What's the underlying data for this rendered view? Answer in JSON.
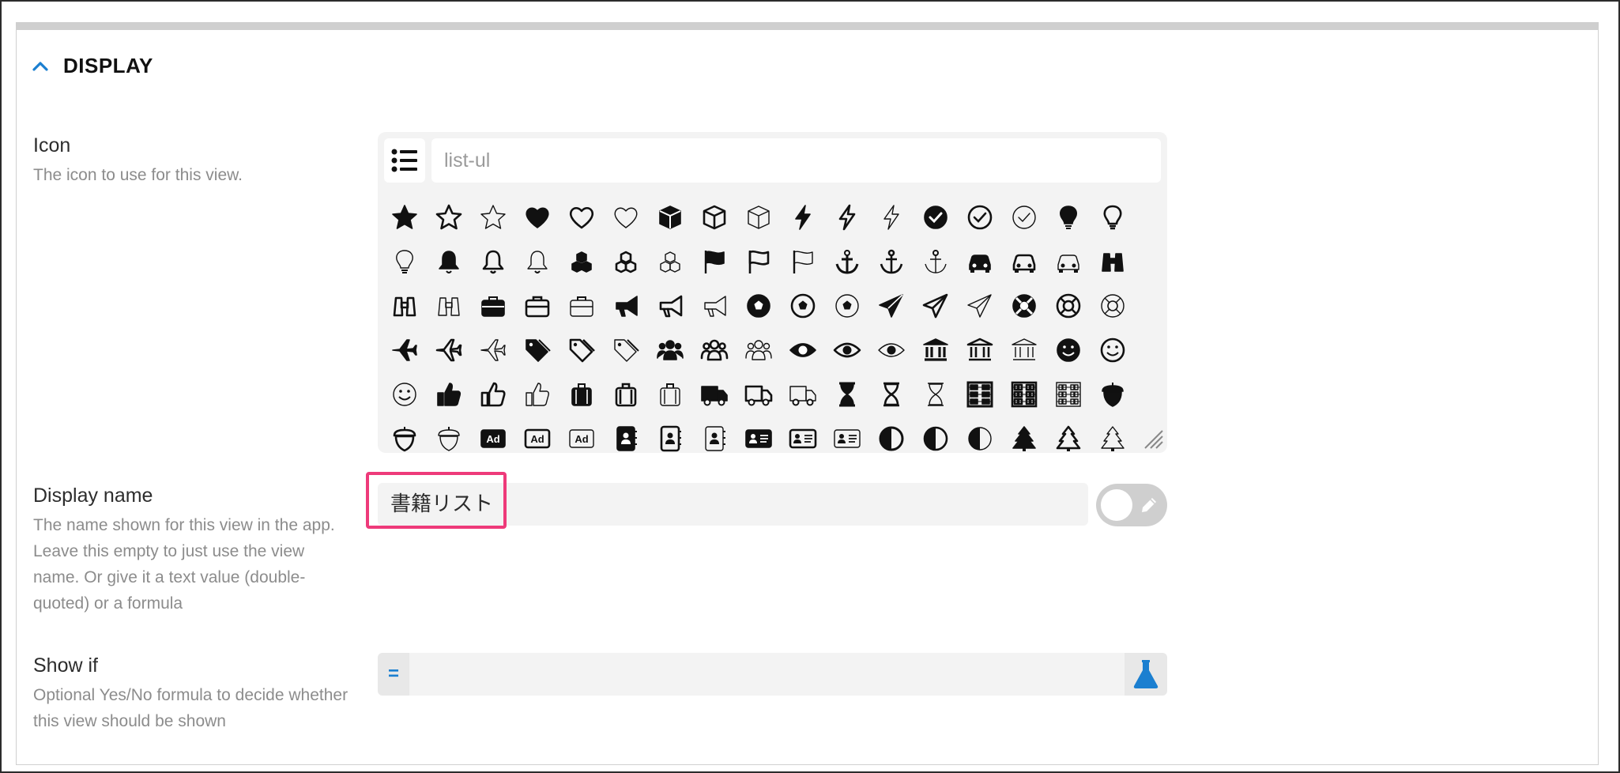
{
  "section": {
    "title": "DISPLAY",
    "expanded": true
  },
  "icon_field": {
    "label": "Icon",
    "description": "The icon to use for this view.",
    "search_placeholder": "list-ul",
    "selected_icon": "list-ul-icon",
    "grid_icons": [
      "star-solid-icon",
      "star-regular-icon",
      "star-light-icon",
      "heart-solid-icon",
      "heart-regular-icon",
      "heart-light-icon",
      "cube-solid-icon",
      "cube-regular-icon",
      "cube-light-icon",
      "bolt-solid-icon",
      "bolt-regular-icon",
      "bolt-light-icon",
      "check-circle-solid-icon",
      "check-circle-regular-icon",
      "check-circle-light-icon",
      "lightbulb-solid-icon",
      "lightbulb-regular-icon",
      "lightbulb-light-icon",
      "bell-solid-icon",
      "bell-regular-icon",
      "bell-light-icon",
      "cubes-solid-icon",
      "cubes-regular-icon",
      "cubes-light-icon",
      "flag-solid-icon",
      "flag-regular-icon",
      "flag-light-icon",
      "anchor-solid-icon",
      "anchor-regular-icon",
      "anchor-light-icon",
      "car-solid-icon",
      "car-regular-icon",
      "car-light-icon",
      "binoculars-solid-icon",
      "binoculars-regular-icon",
      "binoculars-light-icon",
      "briefcase-solid-icon",
      "briefcase-regular-icon",
      "briefcase-light-icon",
      "bullhorn-solid-icon",
      "bullhorn-regular-icon",
      "bullhorn-light-icon",
      "futbol-solid-icon",
      "futbol-regular-icon",
      "futbol-light-icon",
      "paper-plane-solid-icon",
      "paper-plane-regular-icon",
      "paper-plane-light-icon",
      "life-ring-solid-icon",
      "life-ring-regular-icon",
      "life-ring-light-icon",
      "plane-solid-icon",
      "plane-regular-icon",
      "plane-light-icon",
      "tags-solid-icon",
      "tags-regular-icon",
      "tags-light-icon",
      "users-solid-icon",
      "users-regular-icon",
      "users-light-icon",
      "eye-solid-icon",
      "eye-regular-icon",
      "eye-light-icon",
      "university-solid-icon",
      "university-regular-icon",
      "university-light-icon",
      "smile-solid-icon",
      "smile-regular-icon",
      "smile-light-icon",
      "thumbs-up-solid-icon",
      "thumbs-up-regular-icon",
      "thumbs-up-light-icon",
      "suitcase-solid-icon",
      "suitcase-regular-icon",
      "suitcase-light-icon",
      "truck-solid-icon",
      "truck-regular-icon",
      "truck-light-icon",
      "hourglass-solid-icon",
      "hourglass-regular-icon",
      "hourglass-light-icon",
      "abacus-solid-icon",
      "abacus-regular-icon",
      "abacus-light-icon",
      "acorn-solid-icon",
      "acorn-regular-icon",
      "acorn-light-icon",
      "ad-solid-icon",
      "ad-regular-icon",
      "ad-light-icon",
      "address-book-solid-icon",
      "address-book-regular-icon",
      "address-book-light-icon",
      "address-card-solid-icon",
      "address-card-regular-icon",
      "address-card-light-icon",
      "adjust-solid-icon",
      "adjust-regular-icon",
      "adjust-light-icon",
      "alicorn-tree-solid-icon",
      "tree-regular-icon",
      "tree-light-icon"
    ],
    "ad_text": "Ad"
  },
  "display_name_field": {
    "label": "Display name",
    "description": "The name shown for this view in the app. Leave this empty to just use the view name. Or give it a text value (double-quoted) or a formula",
    "value": "書籍リスト"
  },
  "show_if_field": {
    "label": "Show if",
    "description": "Optional Yes/No formula to decide whether this view should be shown",
    "prefix": "=",
    "value": ""
  },
  "colors": {
    "accent": "#1b7fd0",
    "highlight": "#ee3a7a",
    "icon": "#111111"
  }
}
